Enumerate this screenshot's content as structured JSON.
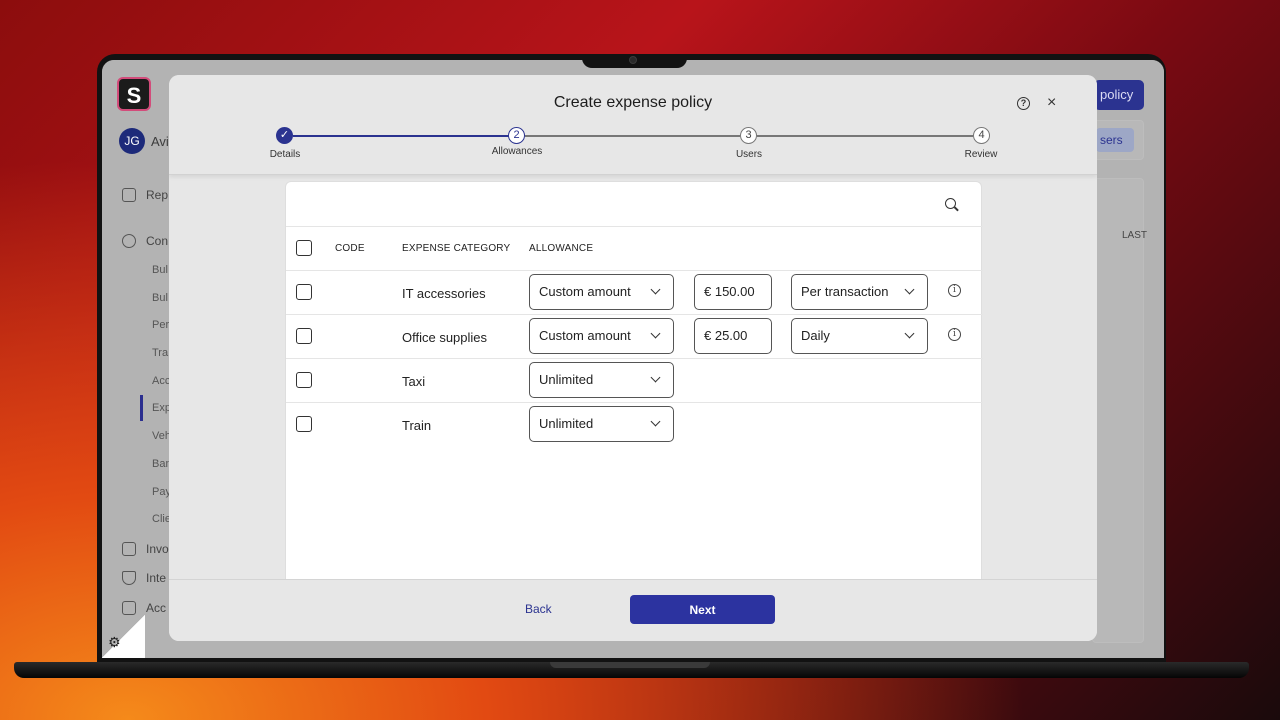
{
  "app": {
    "logo_letter": "S",
    "user_initials": "JG",
    "user_name_partial": "Avia",
    "top_button_partial": "policy",
    "users_chip_partial": "sers",
    "table_header_partial": "LAST",
    "nav": [
      {
        "label": "Rep",
        "icon": "receipt-icon"
      },
      {
        "label": "Con",
        "icon": "gear-icon"
      },
      {
        "label": "Invo",
        "icon": "invoice-icon"
      },
      {
        "label": "Inte",
        "icon": "plug-icon"
      },
      {
        "label": "Acc",
        "icon": "building-icon"
      }
    ],
    "subnav": [
      "Bul",
      "Bul",
      "Per",
      "Tra",
      "Acc",
      "Exp",
      "Veh",
      "Ban",
      "Pay",
      "Clie"
    ],
    "active_subnav": "Exp"
  },
  "modal": {
    "title": "Create expense policy",
    "help_icon": "question-circle-icon",
    "close_icon": "close-icon",
    "steps": [
      {
        "number": "1",
        "label": "Details",
        "state": "completed"
      },
      {
        "number": "2",
        "label": "Allowances",
        "state": "active"
      },
      {
        "number": "3",
        "label": "Users",
        "state": "upcoming"
      },
      {
        "number": "4",
        "label": "Review",
        "state": "upcoming"
      }
    ],
    "table": {
      "headers": {
        "code": "CODE",
        "category": "EXPENSE CATEGORY",
        "allowance": "ALLOWANCE"
      },
      "rows": [
        {
          "category": "IT accessories",
          "allowance_type": "Custom amount",
          "amount": "€ 150.00",
          "frequency": "Per transaction"
        },
        {
          "category": "Office supplies",
          "allowance_type": "Custom amount",
          "amount": "€ 25.00",
          "frequency": "Daily"
        },
        {
          "category": "Taxi",
          "allowance_type": "Unlimited"
        },
        {
          "category": "Train",
          "allowance_type": "Unlimited"
        }
      ]
    },
    "footer": {
      "back_label": "Back",
      "next_label": "Next"
    }
  },
  "colors": {
    "accent": "#2c33a0",
    "stepper_completed": "#2b3390"
  }
}
